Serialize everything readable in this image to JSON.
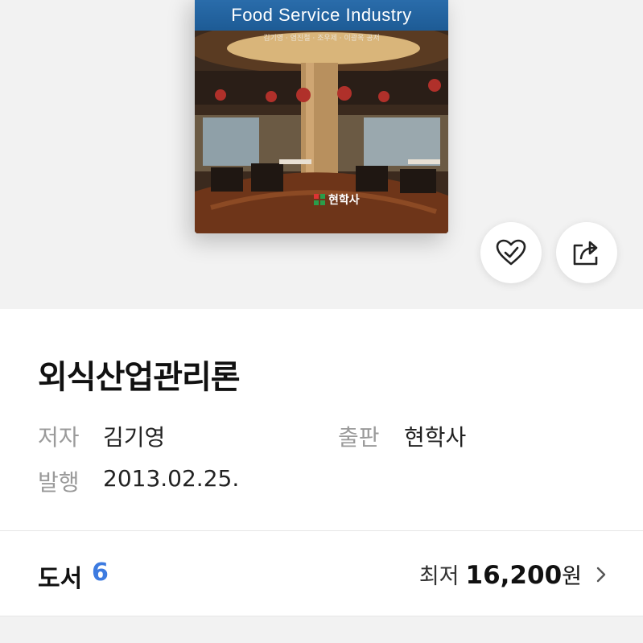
{
  "cover": {
    "title_en": "Food Service Industry",
    "authors": "김기영 · 염진철 · 조우제 · 이광옥 공저",
    "publisher": "현학사"
  },
  "actions": {
    "like_icon": "heart-check-icon",
    "share_icon": "share-icon"
  },
  "book": {
    "title": "외식산업관리론",
    "author_label": "저자",
    "author": "김기영",
    "publisher_label": "출판",
    "publisher": "현학사",
    "published_label": "발행",
    "published_date": "2013.02.25."
  },
  "listing": {
    "label": "도서",
    "count": "6",
    "price_prefix": "최저",
    "price": "16,200",
    "price_unit": "원"
  },
  "colors": {
    "accent": "#3d7be0",
    "hero_bg": "#f2f2f2"
  }
}
